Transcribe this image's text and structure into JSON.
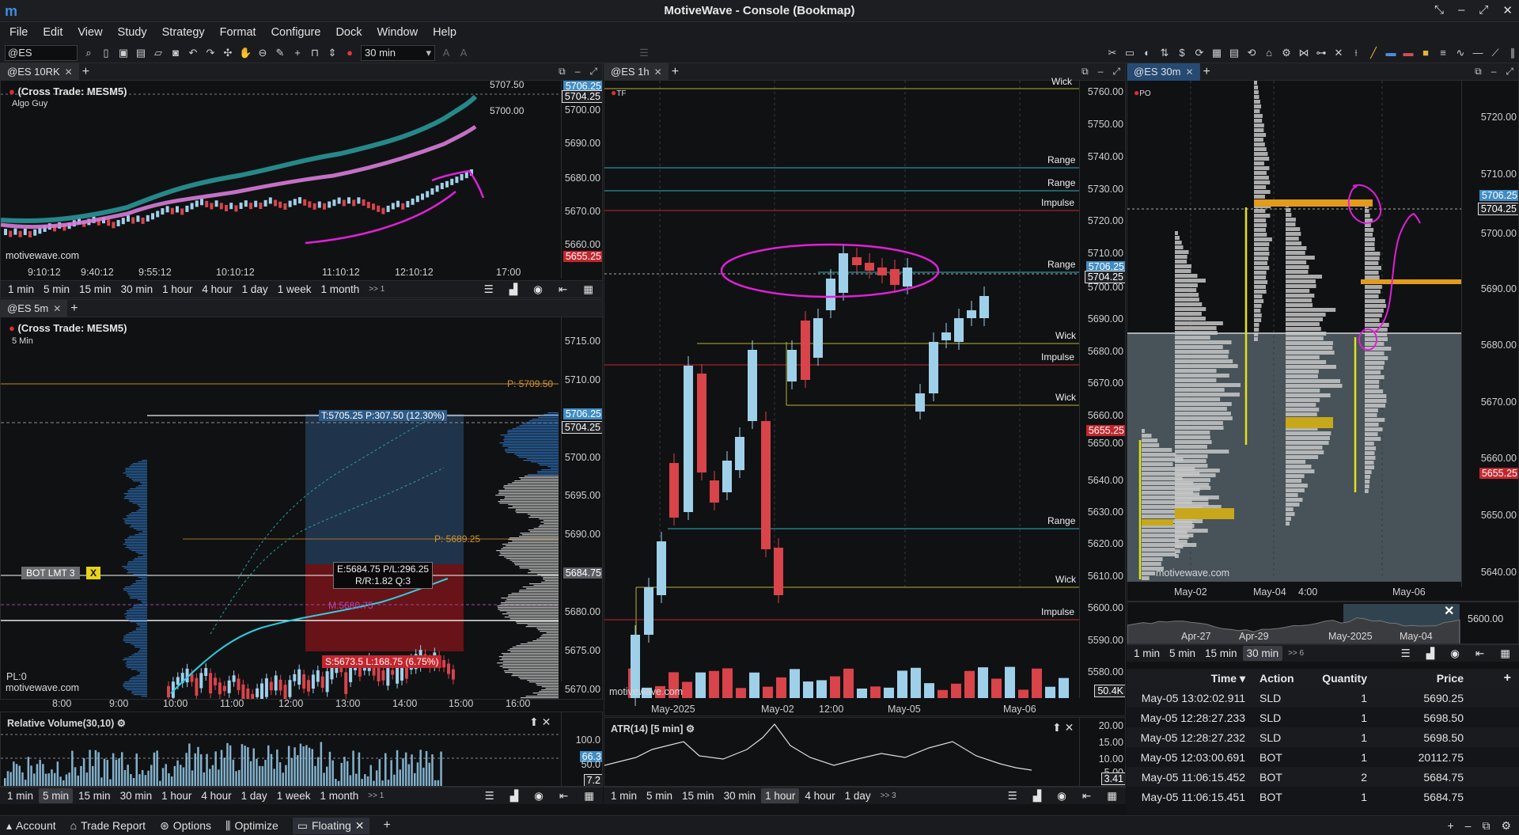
{
  "app": {
    "title": "MotiveWave - Console (Bookmap)",
    "logo": "m"
  },
  "menu": [
    "File",
    "Edit",
    "View",
    "Study",
    "Strategy",
    "Format",
    "Configure",
    "Dock",
    "Window",
    "Help"
  ],
  "toolbar": {
    "symbol": "@ES",
    "bar_size": "30 min"
  },
  "timeframes": [
    "1 min",
    "5 min",
    "15 min",
    "30 min",
    "1 hour",
    "4 hour",
    "1 day",
    "1 week",
    "1 month"
  ],
  "more_glyph": ">> 1",
  "panel_10rk": {
    "tab": "@ES 10RK",
    "cross_trade": "(Cross Trade: MESM5)",
    "study": "Algo Guy",
    "watermark": "motivewave.com",
    "axis_ticks": [
      "5700.00",
      "5690.00",
      "5680.00",
      "5670.00",
      "5660.00"
    ],
    "price_tag_1": "5706.25",
    "price_tag_2": "5704.25",
    "price_tag_low": "5655.25",
    "label_top": "5707.50",
    "label_mid": "5700.00",
    "time_labels": [
      "9:10:12",
      "9:40:12",
      "9:55:12",
      "10:10:12",
      "11:10:12",
      "12:10:12",
      "17:00"
    ]
  },
  "panel_5m": {
    "tab": "@ES 5m",
    "cross_trade": "(Cross Trade: MESM5)",
    "interval": "5 Min",
    "watermark": "motivewave.com",
    "pl": "PL:0",
    "axis_ticks": [
      "5715.00",
      "5710.00",
      "5700.00",
      "5695.00",
      "5690.00",
      "5680.00",
      "5675.00",
      "5670.00"
    ],
    "price_tag_1": "5706.25",
    "price_tag_2": "5704.25",
    "price_tag_3": "5684.75",
    "p_top": "P: 5709.50",
    "p_mid": "P: 5689.25",
    "target": "T:5705.25 P:307.50 (12.30%)",
    "entry": "E:5684.75 P/L:296.25",
    "rr": "R/R:1.82 Q:3",
    "mid": "M:5680.75",
    "stop": "S:5673.5 L:168.75 (6.75%)",
    "order_label": "BOT LMT 3",
    "order_close": "X",
    "time_labels": [
      "8:00",
      "9:00",
      "10:00",
      "11:00",
      "12:00",
      "13:00",
      "14:00",
      "15:00",
      "16:00"
    ],
    "tf_selected": "5 min"
  },
  "rel_volume": {
    "title": "Relative Volume(30,10)",
    "ticks": [
      "100.0",
      "50.0"
    ],
    "tag_1": "66.3",
    "tag_2": "7.2"
  },
  "panel_1h": {
    "tab": "@ES 1h",
    "flag": "TF",
    "watermark": "motivewave.com",
    "axis_ticks": [
      "5760.00",
      "5750.00",
      "5740.00",
      "5730.00",
      "5720.00",
      "5710.00",
      "5700.00",
      "5690.00",
      "5680.00",
      "5670.00",
      "5660.00",
      "5650.00",
      "5640.00",
      "5630.00",
      "5620.00",
      "5610.00",
      "5600.00",
      "5590.00",
      "5580.00"
    ],
    "price_tag_1": "5706.25",
    "price_tag_2": "5704.25",
    "price_tag_low": "5655.25",
    "volume_tag": "50.4K",
    "levels": [
      "Wick",
      "Range",
      "Range",
      "Impulse",
      "Range",
      "Wick",
      "Impulse",
      "Wick",
      "Range",
      "Wick",
      "Impulse"
    ],
    "time_labels": [
      "May-2025",
      "May-02",
      "12:00",
      "May-05",
      "May-06"
    ],
    "tf_selected": "1 hour",
    "timeframes": [
      "1 min",
      "5 min",
      "15 min",
      "30 min",
      "1 hour",
      "4 hour",
      "1 day"
    ],
    "more_glyph": ">> 3"
  },
  "atr": {
    "title": "ATR(14) [5 min]",
    "ticks": [
      "20.00",
      "15.00",
      "10.00",
      "5.00"
    ],
    "tag": "3.41"
  },
  "panel_30m": {
    "tab": "@ES 30m",
    "flag": "PO",
    "watermark": "motivewave.com",
    "axis_ticks": [
      "5720.00",
      "5710.00",
      "5700.00",
      "5690.00",
      "5680.00",
      "5670.00",
      "5660.00",
      "5650.00",
      "5640.00"
    ],
    "price_tag_1": "5706.25",
    "price_tag_2": "5704.25",
    "price_tag_low": "5655.25",
    "time_labels": [
      "May-02",
      "May-04",
      "4:00",
      "May-06"
    ],
    "overview_labels": [
      "Apr-27",
      "Apr-29",
      "May-2025",
      "May-04"
    ],
    "overview_tick": "5600.00",
    "timeframes": [
      "1 min",
      "5 min",
      "15 min",
      "30 min"
    ],
    "tf_selected": "30 min",
    "more_glyph": ">> 6"
  },
  "orders": {
    "headers": [
      "Time",
      "Action",
      "Quantity",
      "Price"
    ],
    "rows": [
      [
        "May-05 13:02:02.911",
        "SLD",
        "1",
        "5690.25"
      ],
      [
        "May-05 12:28:27.233",
        "SLD",
        "1",
        "5698.50"
      ],
      [
        "May-05 12:28:27.232",
        "SLD",
        "1",
        "5698.50"
      ],
      [
        "May-05 12:03:00.691",
        "BOT",
        "1",
        "20112.75"
      ],
      [
        "May-05 11:06:15.452",
        "BOT",
        "2",
        "5684.75"
      ],
      [
        "May-05 11:06:15.451",
        "BOT",
        "1",
        "5684.75"
      ]
    ]
  },
  "status": {
    "items": [
      "Account",
      "Trade Report",
      "Options",
      "Optimize",
      "Floating"
    ]
  },
  "colors": {
    "bull": "#9fd0ea",
    "bear": "#d9434a",
    "annotation": "#e020d8",
    "cyan": "#2ad0e0",
    "level_yellow": "#b9b22e",
    "level_red": "#c4262e",
    "level_cyan": "#2bb3b8"
  }
}
